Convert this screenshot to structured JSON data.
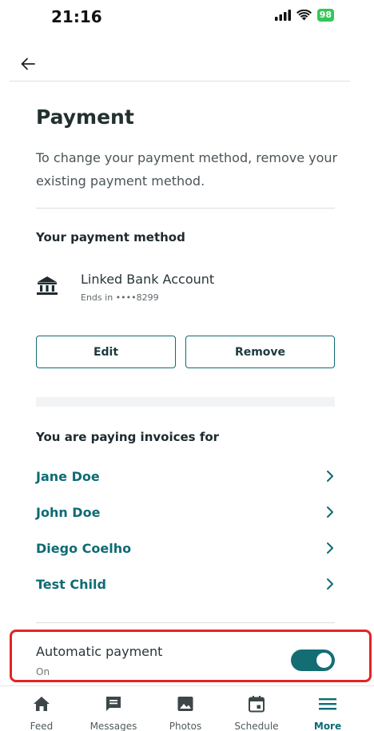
{
  "status_bar": {
    "time": "21:16",
    "battery": "98"
  },
  "header": {
    "back_icon": "arrow-left-icon"
  },
  "page": {
    "title": "Payment",
    "description": "To change your payment method, remove your existing payment method."
  },
  "payment_method": {
    "section_title": "Your payment method",
    "icon": "bank-icon",
    "account_name": "Linked Bank Account",
    "ends_in": "Ends in ••••8299",
    "edit_label": "Edit",
    "remove_label": "Remove"
  },
  "invoices": {
    "section_title": "You are paying invoices for",
    "children": [
      {
        "name": "Jane Doe"
      },
      {
        "name": "John Doe"
      },
      {
        "name": "Diego Coelho"
      },
      {
        "name": "Test Child"
      }
    ]
  },
  "automatic_payment": {
    "label": "Automatic payment",
    "status": "On",
    "enabled": true
  },
  "tab_bar": {
    "tabs": [
      {
        "label": "Feed",
        "icon": "home-icon"
      },
      {
        "label": "Messages",
        "icon": "message-icon"
      },
      {
        "label": "Photos",
        "icon": "photo-icon"
      },
      {
        "label": "Schedule",
        "icon": "calendar-icon"
      },
      {
        "label": "More",
        "icon": "menu-icon",
        "active": true
      }
    ]
  },
  "colors": {
    "accent": "#0e6b74",
    "highlight": "#e32424"
  }
}
